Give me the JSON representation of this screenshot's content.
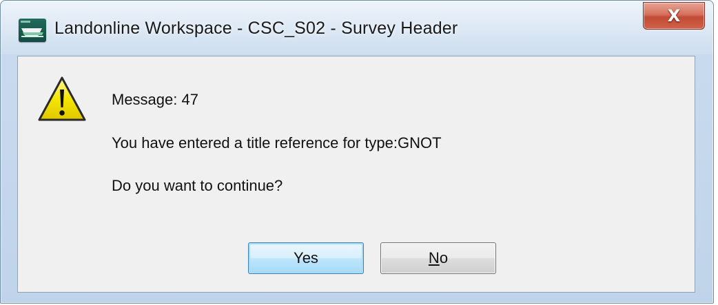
{
  "window": {
    "title": "Landonline Workspace - CSC_S02 - Survey Header",
    "app_icon": "landonline-app-icon",
    "close_icon": "close-x-icon",
    "close_label": "X"
  },
  "dialog": {
    "icon": "warning-triangle-icon",
    "message_number": "Message: 47",
    "message_text": "You have entered a title reference for type:GNOT",
    "question": "Do you want to continue?"
  },
  "buttons": {
    "yes_label": "Yes",
    "no_mnemonic": "N",
    "no_rest": "o"
  },
  "colors": {
    "warning_yellow": "#f5e600",
    "default_button_border": "#3c7fb1",
    "close_button_red": "#c24b35"
  }
}
